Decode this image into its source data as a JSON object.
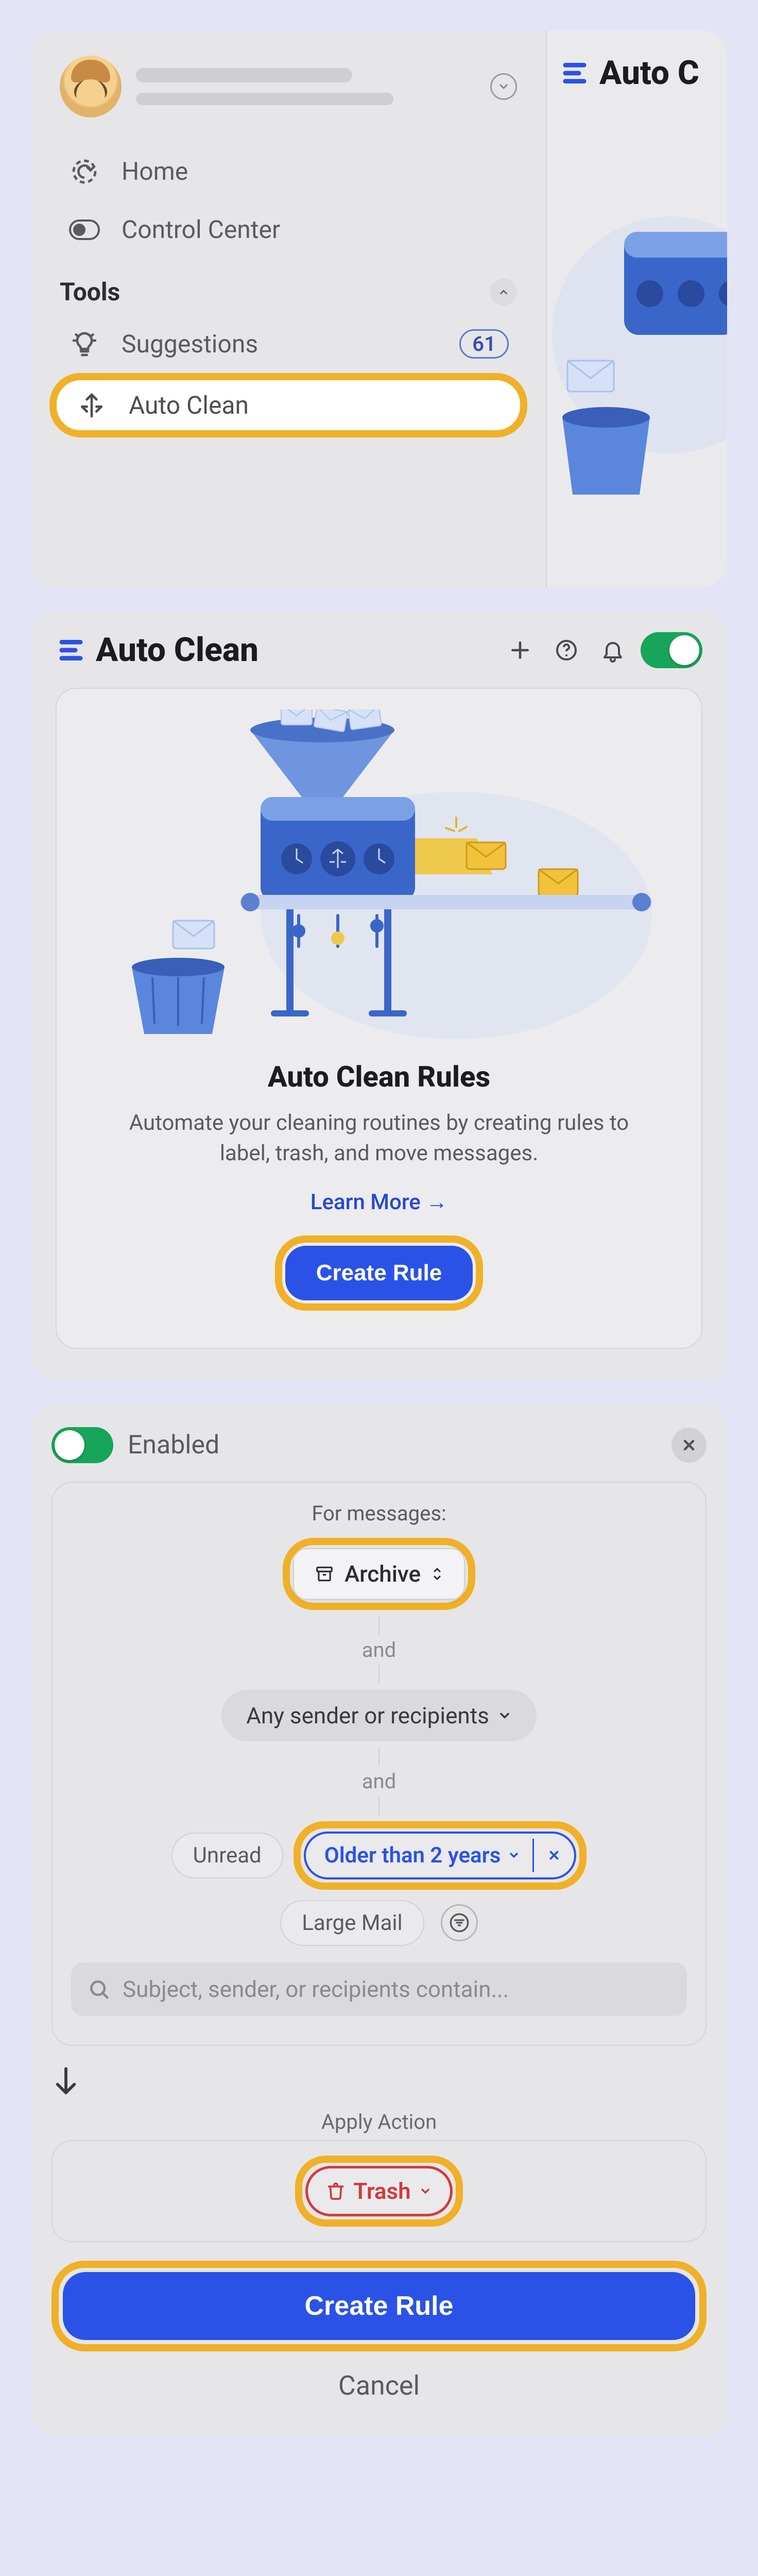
{
  "panel1": {
    "nav": {
      "home": "Home",
      "control_center": "Control Center",
      "tools_heading": "Tools",
      "suggestions": "Suggestions",
      "suggestions_count": "61",
      "auto_clean": "Auto Clean"
    },
    "right_title": "Auto C"
  },
  "panel2": {
    "title": "Auto Clean",
    "card": {
      "heading": "Auto Clean Rules",
      "subtext": "Automate your cleaning routines by creating rules to label, trash, and move messages.",
      "learn_more": "Learn More →",
      "create_rule": "Create Rule"
    }
  },
  "panel3": {
    "enabled_label": "Enabled",
    "for_messages": "For messages:",
    "archive_label": "Archive",
    "and": "and",
    "any_sender": "Any sender or recipients",
    "chip_unread": "Unread",
    "chip_older": "Older than 2 years",
    "chip_large": "Large Mail",
    "search_placeholder": "Subject, sender, or recipients contain...",
    "apply_action": "Apply Action",
    "trash_label": "Trash",
    "create_rule": "Create Rule",
    "cancel": "Cancel"
  }
}
